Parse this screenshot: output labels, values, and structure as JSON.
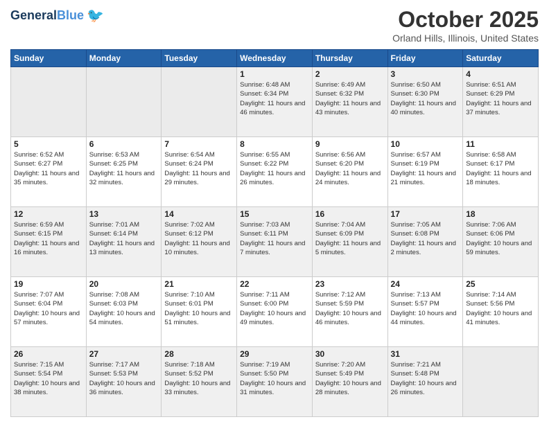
{
  "header": {
    "logo_line1": "General",
    "logo_line2": "Blue",
    "month": "October 2025",
    "location": "Orland Hills, Illinois, United States"
  },
  "days_of_week": [
    "Sunday",
    "Monday",
    "Tuesday",
    "Wednesday",
    "Thursday",
    "Friday",
    "Saturday"
  ],
  "weeks": [
    [
      {
        "day": "",
        "info": ""
      },
      {
        "day": "",
        "info": ""
      },
      {
        "day": "",
        "info": ""
      },
      {
        "day": "1",
        "info": "Sunrise: 6:48 AM\nSunset: 6:34 PM\nDaylight: 11 hours and 46 minutes."
      },
      {
        "day": "2",
        "info": "Sunrise: 6:49 AM\nSunset: 6:32 PM\nDaylight: 11 hours and 43 minutes."
      },
      {
        "day": "3",
        "info": "Sunrise: 6:50 AM\nSunset: 6:30 PM\nDaylight: 11 hours and 40 minutes."
      },
      {
        "day": "4",
        "info": "Sunrise: 6:51 AM\nSunset: 6:29 PM\nDaylight: 11 hours and 37 minutes."
      }
    ],
    [
      {
        "day": "5",
        "info": "Sunrise: 6:52 AM\nSunset: 6:27 PM\nDaylight: 11 hours and 35 minutes."
      },
      {
        "day": "6",
        "info": "Sunrise: 6:53 AM\nSunset: 6:25 PM\nDaylight: 11 hours and 32 minutes."
      },
      {
        "day": "7",
        "info": "Sunrise: 6:54 AM\nSunset: 6:24 PM\nDaylight: 11 hours and 29 minutes."
      },
      {
        "day": "8",
        "info": "Sunrise: 6:55 AM\nSunset: 6:22 PM\nDaylight: 11 hours and 26 minutes."
      },
      {
        "day": "9",
        "info": "Sunrise: 6:56 AM\nSunset: 6:20 PM\nDaylight: 11 hours and 24 minutes."
      },
      {
        "day": "10",
        "info": "Sunrise: 6:57 AM\nSunset: 6:19 PM\nDaylight: 11 hours and 21 minutes."
      },
      {
        "day": "11",
        "info": "Sunrise: 6:58 AM\nSunset: 6:17 PM\nDaylight: 11 hours and 18 minutes."
      }
    ],
    [
      {
        "day": "12",
        "info": "Sunrise: 6:59 AM\nSunset: 6:15 PM\nDaylight: 11 hours and 16 minutes."
      },
      {
        "day": "13",
        "info": "Sunrise: 7:01 AM\nSunset: 6:14 PM\nDaylight: 11 hours and 13 minutes."
      },
      {
        "day": "14",
        "info": "Sunrise: 7:02 AM\nSunset: 6:12 PM\nDaylight: 11 hours and 10 minutes."
      },
      {
        "day": "15",
        "info": "Sunrise: 7:03 AM\nSunset: 6:11 PM\nDaylight: 11 hours and 7 minutes."
      },
      {
        "day": "16",
        "info": "Sunrise: 7:04 AM\nSunset: 6:09 PM\nDaylight: 11 hours and 5 minutes."
      },
      {
        "day": "17",
        "info": "Sunrise: 7:05 AM\nSunset: 6:08 PM\nDaylight: 11 hours and 2 minutes."
      },
      {
        "day": "18",
        "info": "Sunrise: 7:06 AM\nSunset: 6:06 PM\nDaylight: 10 hours and 59 minutes."
      }
    ],
    [
      {
        "day": "19",
        "info": "Sunrise: 7:07 AM\nSunset: 6:04 PM\nDaylight: 10 hours and 57 minutes."
      },
      {
        "day": "20",
        "info": "Sunrise: 7:08 AM\nSunset: 6:03 PM\nDaylight: 10 hours and 54 minutes."
      },
      {
        "day": "21",
        "info": "Sunrise: 7:10 AM\nSunset: 6:01 PM\nDaylight: 10 hours and 51 minutes."
      },
      {
        "day": "22",
        "info": "Sunrise: 7:11 AM\nSunset: 6:00 PM\nDaylight: 10 hours and 49 minutes."
      },
      {
        "day": "23",
        "info": "Sunrise: 7:12 AM\nSunset: 5:59 PM\nDaylight: 10 hours and 46 minutes."
      },
      {
        "day": "24",
        "info": "Sunrise: 7:13 AM\nSunset: 5:57 PM\nDaylight: 10 hours and 44 minutes."
      },
      {
        "day": "25",
        "info": "Sunrise: 7:14 AM\nSunset: 5:56 PM\nDaylight: 10 hours and 41 minutes."
      }
    ],
    [
      {
        "day": "26",
        "info": "Sunrise: 7:15 AM\nSunset: 5:54 PM\nDaylight: 10 hours and 38 minutes."
      },
      {
        "day": "27",
        "info": "Sunrise: 7:17 AM\nSunset: 5:53 PM\nDaylight: 10 hours and 36 minutes."
      },
      {
        "day": "28",
        "info": "Sunrise: 7:18 AM\nSunset: 5:52 PM\nDaylight: 10 hours and 33 minutes."
      },
      {
        "day": "29",
        "info": "Sunrise: 7:19 AM\nSunset: 5:50 PM\nDaylight: 10 hours and 31 minutes."
      },
      {
        "day": "30",
        "info": "Sunrise: 7:20 AM\nSunset: 5:49 PM\nDaylight: 10 hours and 28 minutes."
      },
      {
        "day": "31",
        "info": "Sunrise: 7:21 AM\nSunset: 5:48 PM\nDaylight: 10 hours and 26 minutes."
      },
      {
        "day": "",
        "info": ""
      }
    ]
  ]
}
